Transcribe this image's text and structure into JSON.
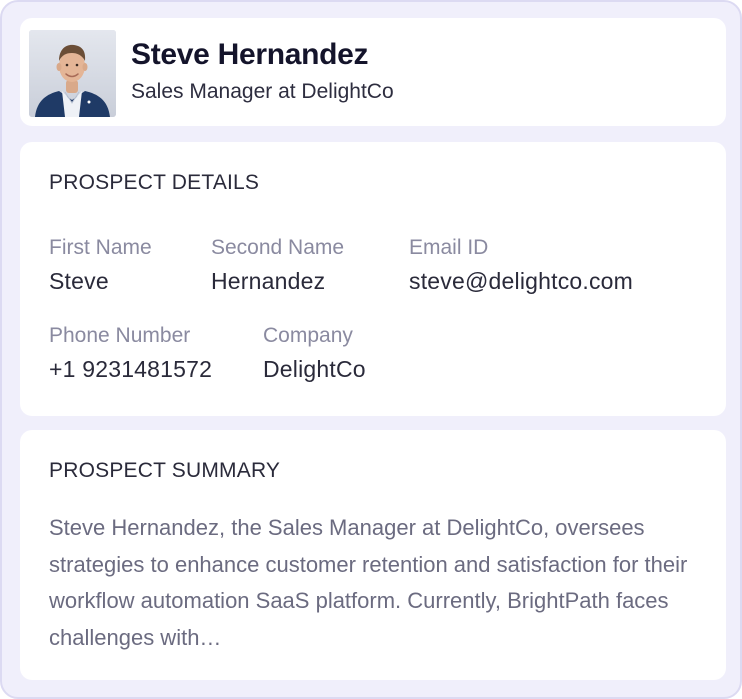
{
  "profile": {
    "name": "Steve Hernandez",
    "role": "Sales Manager at DelightCo"
  },
  "details": {
    "title": "PROSPECT DETAILS",
    "fields": [
      {
        "label": "First Name",
        "value": "Steve"
      },
      {
        "label": "Second Name",
        "value": "Hernandez"
      },
      {
        "label": "Email ID",
        "value": "steve@delightco.com"
      },
      {
        "label": "Phone Number",
        "value": "+1 9231481572"
      },
      {
        "label": "Company",
        "value": "DelightCo"
      }
    ]
  },
  "summary": {
    "title": "PROSPECT SUMMARY",
    "text": "Steve Hernandez, the Sales Manager at DelightCo, oversees strategies to enhance customer retention and satisfaction for their workflow automation SaaS platform. Currently, BrightPath faces challenges with…"
  },
  "colors": {
    "outer_background": "#f0effb",
    "card_background": "#ffffff",
    "heading_text": "#14142b",
    "label_text": "#8a8aa0",
    "value_text": "#2a2a3a",
    "summary_text": "#6b6b80"
  }
}
